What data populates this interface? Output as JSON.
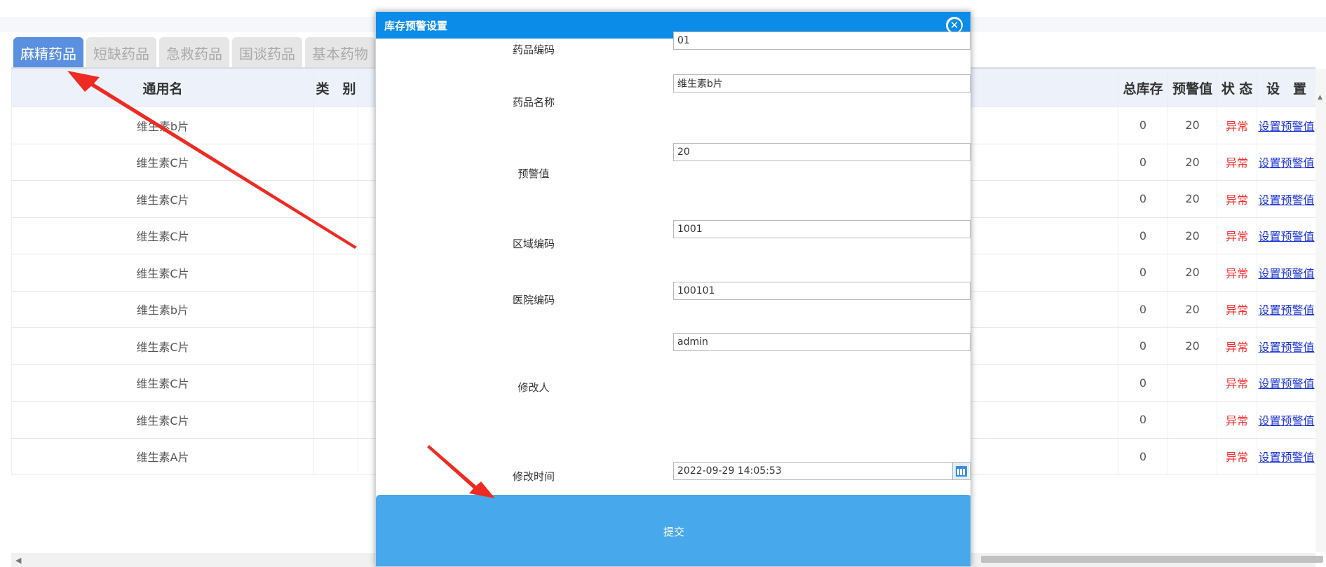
{
  "tabs": [
    {
      "label": "麻精药品",
      "active": true
    },
    {
      "label": "短缺药品",
      "active": false
    },
    {
      "label": "急救药品",
      "active": false
    },
    {
      "label": "国谈药品",
      "active": false
    },
    {
      "label": "基本药物",
      "active": false
    }
  ],
  "table": {
    "headers": {
      "name": "通用名",
      "category": "类　别",
      "total_stock": "总库存",
      "warning_value": "预警值",
      "status": "状 态",
      "settings": "设　置"
    },
    "rows": [
      {
        "name": "维生素b片",
        "category": "",
        "total_stock": "0",
        "warning_value": "20",
        "status": "异常",
        "action": "设置预警值"
      },
      {
        "name": "维生素C片",
        "category": "",
        "total_stock": "0",
        "warning_value": "20",
        "status": "异常",
        "action": "设置预警值"
      },
      {
        "name": "维生素C片",
        "category": "",
        "total_stock": "0",
        "warning_value": "20",
        "status": "异常",
        "action": "设置预警值"
      },
      {
        "name": "维生素C片",
        "category": "",
        "total_stock": "0",
        "warning_value": "20",
        "status": "异常",
        "action": "设置预警值"
      },
      {
        "name": "维生素C片",
        "category": "",
        "total_stock": "0",
        "warning_value": "20",
        "status": "异常",
        "action": "设置预警值"
      },
      {
        "name": "维生素b片",
        "category": "",
        "total_stock": "0",
        "warning_value": "20",
        "status": "异常",
        "action": "设置预警值"
      },
      {
        "name": "维生素C片",
        "category": "",
        "total_stock": "0",
        "warning_value": "20",
        "status": "异常",
        "action": "设置预警值"
      },
      {
        "name": "维生素C片",
        "category": "",
        "total_stock": "0",
        "warning_value": "",
        "status": "异常",
        "action": "设置预警值"
      },
      {
        "name": "维生素C片",
        "category": "",
        "total_stock": "0",
        "warning_value": "",
        "status": "异常",
        "action": "设置预警值"
      },
      {
        "name": "维生素A片",
        "category": "",
        "total_stock": "0",
        "warning_value": "",
        "status": "异常",
        "action": "设置预警值"
      }
    ]
  },
  "modal": {
    "title": "库存预警设置",
    "close_icon": "close-circle-icon",
    "fields": {
      "drug_code": {
        "label": "药品编码",
        "value": "01"
      },
      "drug_name": {
        "label": "药品名称",
        "value": "维生素b片"
      },
      "warning_value": {
        "label": "预警值",
        "value": "20"
      },
      "area_code": {
        "label": "区域编码",
        "value": "1001"
      },
      "hospital_code": {
        "label": "医院编码",
        "value": "100101"
      },
      "modifier": {
        "label": "修改人",
        "value": "admin"
      },
      "modify_time": {
        "label": "修改时间",
        "value": "2022-09-29 14:05:53"
      }
    },
    "calendar_icon": "calendar-icon",
    "submit_label": "提交"
  },
  "colors": {
    "tab_active": "#5b8fe0",
    "modal_header": "#0c8ce9",
    "submit_button": "#47a8eb",
    "status_abnormal": "#ff2a2a",
    "link": "#1a33d6",
    "annotation_arrow": "#ee2b23"
  }
}
